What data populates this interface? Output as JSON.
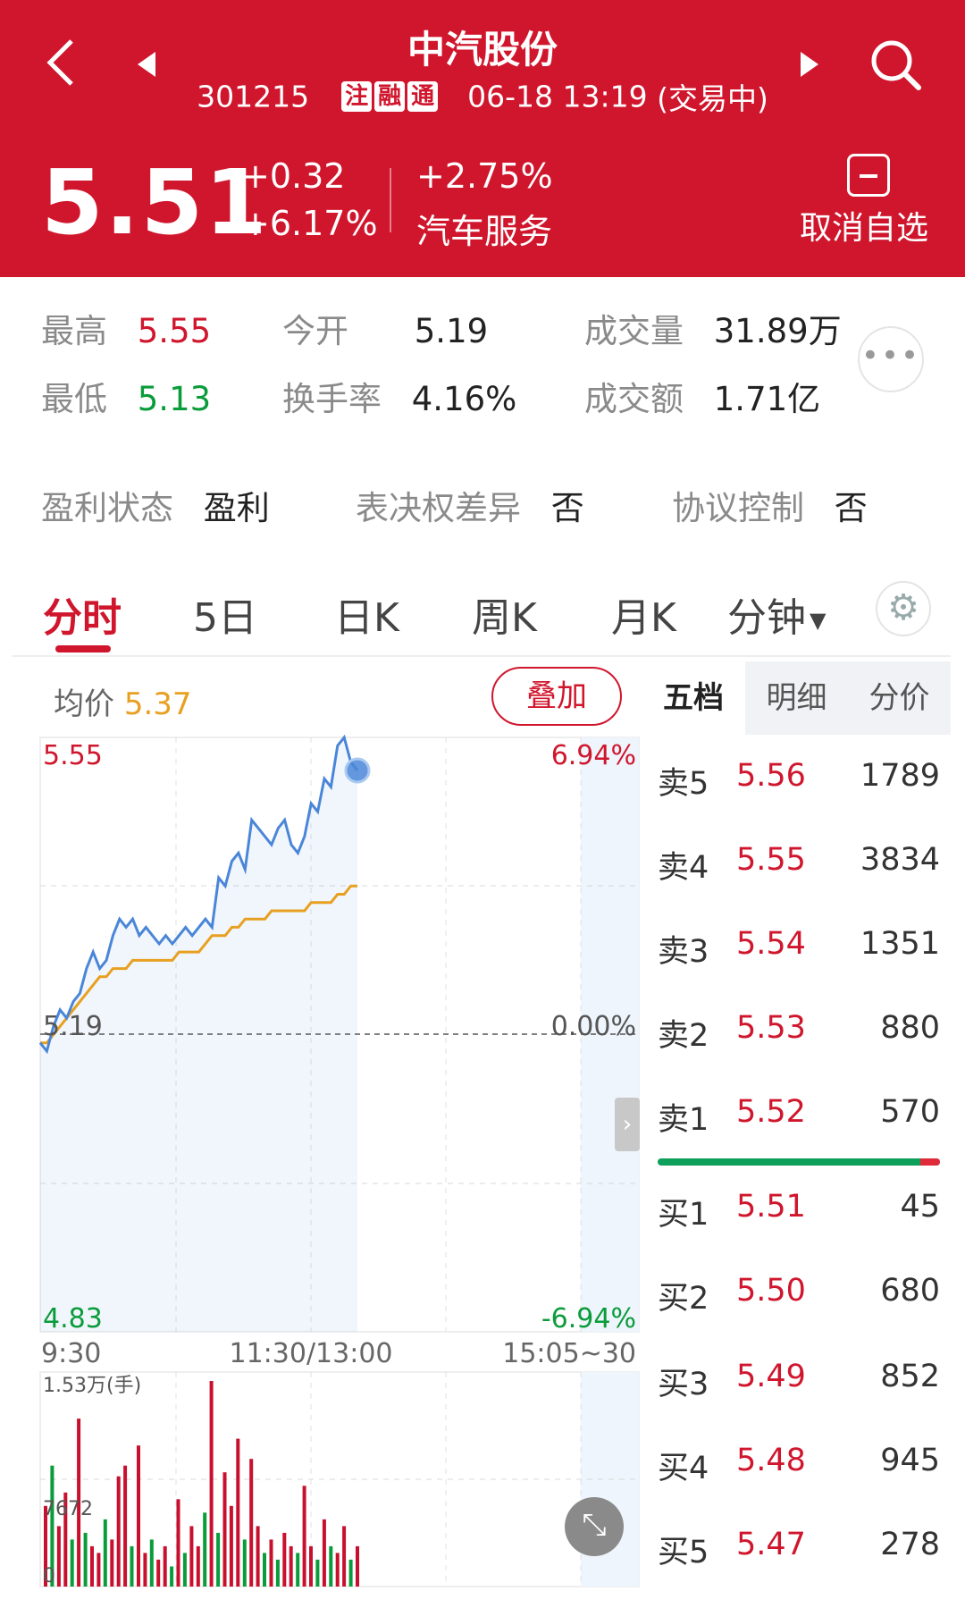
{
  "header": {
    "title": "中汽股份",
    "code": "301215",
    "tags": [
      "注",
      "融",
      "通"
    ],
    "datetime": "06-18 13:19",
    "status": "(交易中)",
    "price": "5.51",
    "change_abs": "+0.32",
    "change_pct": "+6.17%",
    "industry_change": "+2.75%",
    "industry": "汽车服务",
    "fav_label": "取消自选"
  },
  "stats": {
    "high_label": "最高",
    "high": "5.55",
    "low_label": "最低",
    "low": "5.13",
    "open_label": "今开",
    "open": "5.19",
    "turnover_label": "换手率",
    "turnover": "4.16%",
    "volume_label": "成交量",
    "volume": "31.89万",
    "amount_label": "成交额",
    "amount": "1.71亿",
    "profit_label": "盈利状态",
    "profit": "盈利",
    "vote_label": "表决权差异",
    "vote": "否",
    "control_label": "协议控制",
    "control": "否"
  },
  "tabs": [
    "分时",
    "5日",
    "日K",
    "周K",
    "月K",
    "分钟"
  ],
  "chart_header": {
    "avg_label": "均价",
    "avg_value": "5.37",
    "overlay": "叠加"
  },
  "orderbook_tabs": [
    "五档",
    "明细",
    "分价"
  ],
  "orderbook": {
    "sell": [
      {
        "label": "卖5",
        "price": "5.56",
        "vol": "1789"
      },
      {
        "label": "卖4",
        "price": "5.55",
        "vol": "3834"
      },
      {
        "label": "卖3",
        "price": "5.54",
        "vol": "1351"
      },
      {
        "label": "卖2",
        "price": "5.53",
        "vol": "880"
      },
      {
        "label": "卖1",
        "price": "5.52",
        "vol": "570"
      }
    ],
    "buy": [
      {
        "label": "买1",
        "price": "5.51",
        "vol": "45"
      },
      {
        "label": "买2",
        "price": "5.50",
        "vol": "680"
      },
      {
        "label": "买3",
        "price": "5.49",
        "vol": "852"
      },
      {
        "label": "买4",
        "price": "5.48",
        "vol": "945"
      },
      {
        "label": "买5",
        "price": "5.47",
        "vol": "278"
      }
    ],
    "buy_ratio": 0.93
  },
  "colors": {
    "brand": "#d0162d",
    "price_line": "#4a86d8",
    "avg_line": "#e8a020",
    "up": "#c8102e",
    "down": "#0a9c3a"
  },
  "chart_data": {
    "type": "line",
    "x_ticks": [
      "9:30",
      "11:30/13:00",
      "15:05~30"
    ],
    "ylim": [
      4.83,
      5.55
    ],
    "y_labels": {
      "top": "5.55",
      "mid": "5.19",
      "bottom": "4.83"
    },
    "pct_labels": {
      "top": "6.94%",
      "mid": "0.00%",
      "bottom": "-6.94%"
    },
    "prev_close": 5.19,
    "price": [
      5.18,
      5.17,
      5.2,
      5.22,
      5.21,
      5.23,
      5.24,
      5.27,
      5.29,
      5.27,
      5.28,
      5.31,
      5.33,
      5.32,
      5.33,
      5.31,
      5.32,
      5.31,
      5.3,
      5.31,
      5.3,
      5.31,
      5.32,
      5.31,
      5.32,
      5.33,
      5.32,
      5.38,
      5.37,
      5.4,
      5.41,
      5.39,
      5.45,
      5.44,
      5.43,
      5.42,
      5.44,
      5.45,
      5.42,
      5.41,
      5.43,
      5.47,
      5.46,
      5.5,
      5.49,
      5.54,
      5.55,
      5.52,
      5.51
    ],
    "avg": [
      5.18,
      5.18,
      5.19,
      5.2,
      5.21,
      5.22,
      5.23,
      5.24,
      5.25,
      5.26,
      5.26,
      5.27,
      5.27,
      5.27,
      5.28,
      5.28,
      5.28,
      5.28,
      5.28,
      5.28,
      5.28,
      5.29,
      5.29,
      5.29,
      5.29,
      5.3,
      5.31,
      5.31,
      5.31,
      5.32,
      5.32,
      5.33,
      5.33,
      5.33,
      5.33,
      5.34,
      5.34,
      5.34,
      5.34,
      5.34,
      5.34,
      5.35,
      5.35,
      5.35,
      5.35,
      5.36,
      5.36,
      5.37,
      5.37
    ],
    "volume_labels": {
      "top": "1.53万(手)",
      "mid": "7672",
      "zero": "0"
    },
    "volume_max": 15300,
    "volume": [
      {
        "v": 6000,
        "up": true
      },
      {
        "v": 9000,
        "up": false
      },
      {
        "v": 4500,
        "up": true
      },
      {
        "v": 7000,
        "up": true
      },
      {
        "v": 3500,
        "up": false
      },
      {
        "v": 12500,
        "up": true
      },
      {
        "v": 4000,
        "up": false
      },
      {
        "v": 3000,
        "up": true
      },
      {
        "v": 2500,
        "up": true
      },
      {
        "v": 5000,
        "up": false
      },
      {
        "v": 3500,
        "up": true
      },
      {
        "v": 8200,
        "up": true
      },
      {
        "v": 9000,
        "up": true
      },
      {
        "v": 3000,
        "up": false
      },
      {
        "v": 10500,
        "up": true
      },
      {
        "v": 2500,
        "up": true
      },
      {
        "v": 3500,
        "up": false
      },
      {
        "v": 2000,
        "up": true
      },
      {
        "v": 3000,
        "up": true
      },
      {
        "v": 1500,
        "up": false
      },
      {
        "v": 6500,
        "up": true
      },
      {
        "v": 2500,
        "up": false
      },
      {
        "v": 4500,
        "up": true
      },
      {
        "v": 3000,
        "up": true
      },
      {
        "v": 5500,
        "up": false
      },
      {
        "v": 15300,
        "up": true
      },
      {
        "v": 4000,
        "up": false
      },
      {
        "v": 8500,
        "up": true
      },
      {
        "v": 6000,
        "up": true
      },
      {
        "v": 11000,
        "up": true
      },
      {
        "v": 3500,
        "up": false
      },
      {
        "v": 9500,
        "up": true
      },
      {
        "v": 4500,
        "up": true
      },
      {
        "v": 2500,
        "up": false
      },
      {
        "v": 3500,
        "up": true
      },
      {
        "v": 2000,
        "up": false
      },
      {
        "v": 4000,
        "up": true
      },
      {
        "v": 3000,
        "up": true
      },
      {
        "v": 2500,
        "up": false
      },
      {
        "v": 7500,
        "up": true
      },
      {
        "v": 3000,
        "up": true
      },
      {
        "v": 2000,
        "up": false
      },
      {
        "v": 5000,
        "up": true
      },
      {
        "v": 3000,
        "up": false
      },
      {
        "v": 2500,
        "up": true
      },
      {
        "v": 4500,
        "up": true
      },
      {
        "v": 2000,
        "up": false
      },
      {
        "v": 3000,
        "up": true
      }
    ]
  }
}
